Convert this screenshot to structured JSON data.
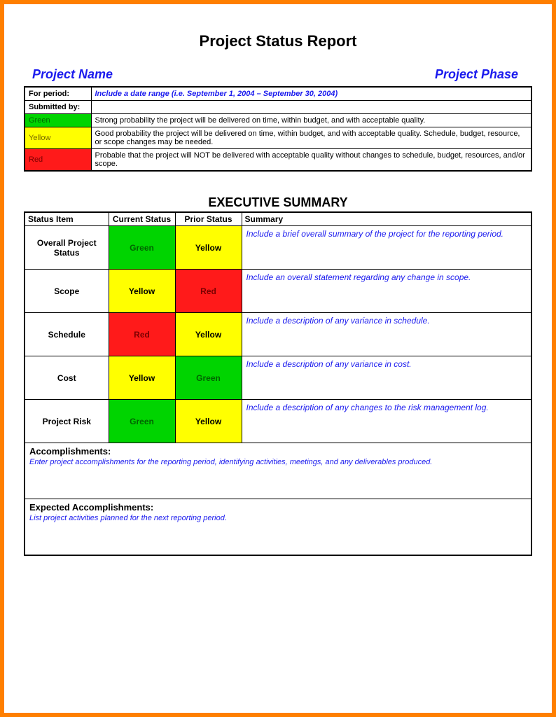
{
  "title": "Project Status Report",
  "subheader": {
    "left": "Project Name",
    "right": "Project Phase"
  },
  "info": {
    "period_label": "For period:",
    "period_value": "Include a date range (i.e. September 1, 2004 – September 30, 2004)",
    "submitted_label": "Submitted by:",
    "submitted_value": ""
  },
  "legend": [
    {
      "key": "Green",
      "desc": "Strong probability the project will be delivered on time, within budget, and with acceptable quality."
    },
    {
      "key": "Yellow",
      "desc": "Good probability the project will be delivered on time, within budget, and with acceptable quality. Schedule, budget, resource, or scope changes may be needed."
    },
    {
      "key": "Red",
      "desc": "Probable that the project will NOT be delivered with acceptable quality without changes to schedule, budget, resources, and/or scope."
    }
  ],
  "exec_title": "EXECUTIVE SUMMARY",
  "exec_headers": {
    "item": "Status Item",
    "current": "Current Status",
    "prior": "Prior Status",
    "summary": "Summary"
  },
  "exec_rows": [
    {
      "item": "Overall Project Status",
      "current": "Green",
      "prior": "Yellow",
      "summary": "Include a brief overall summary of the project for the reporting period."
    },
    {
      "item": "Scope",
      "current": "Yellow",
      "prior": "Red",
      "summary": "Include an overall statement regarding any change in scope."
    },
    {
      "item": "Schedule",
      "current": "Red",
      "prior": "Yellow",
      "summary": "Include a description of any variance in schedule."
    },
    {
      "item": "Cost",
      "current": "Yellow",
      "prior": "Green",
      "summary": "Include a description of any variance in cost."
    },
    {
      "item": "Project Risk",
      "current": "Green",
      "prior": "Yellow",
      "summary": "Include a description of any changes to the risk management log."
    }
  ],
  "sections": {
    "accomp_heading": "Accomplishments:",
    "accomp_body": "Enter project accomplishments for the reporting period, identifying activities, meetings, and any deliverables produced.",
    "expected_heading": "Expected Accomplishments:",
    "expected_body": "List project activities planned for the next reporting period."
  },
  "colors": {
    "green": "#00d400",
    "yellow": "#ffff00",
    "red": "#ff1a1a"
  }
}
